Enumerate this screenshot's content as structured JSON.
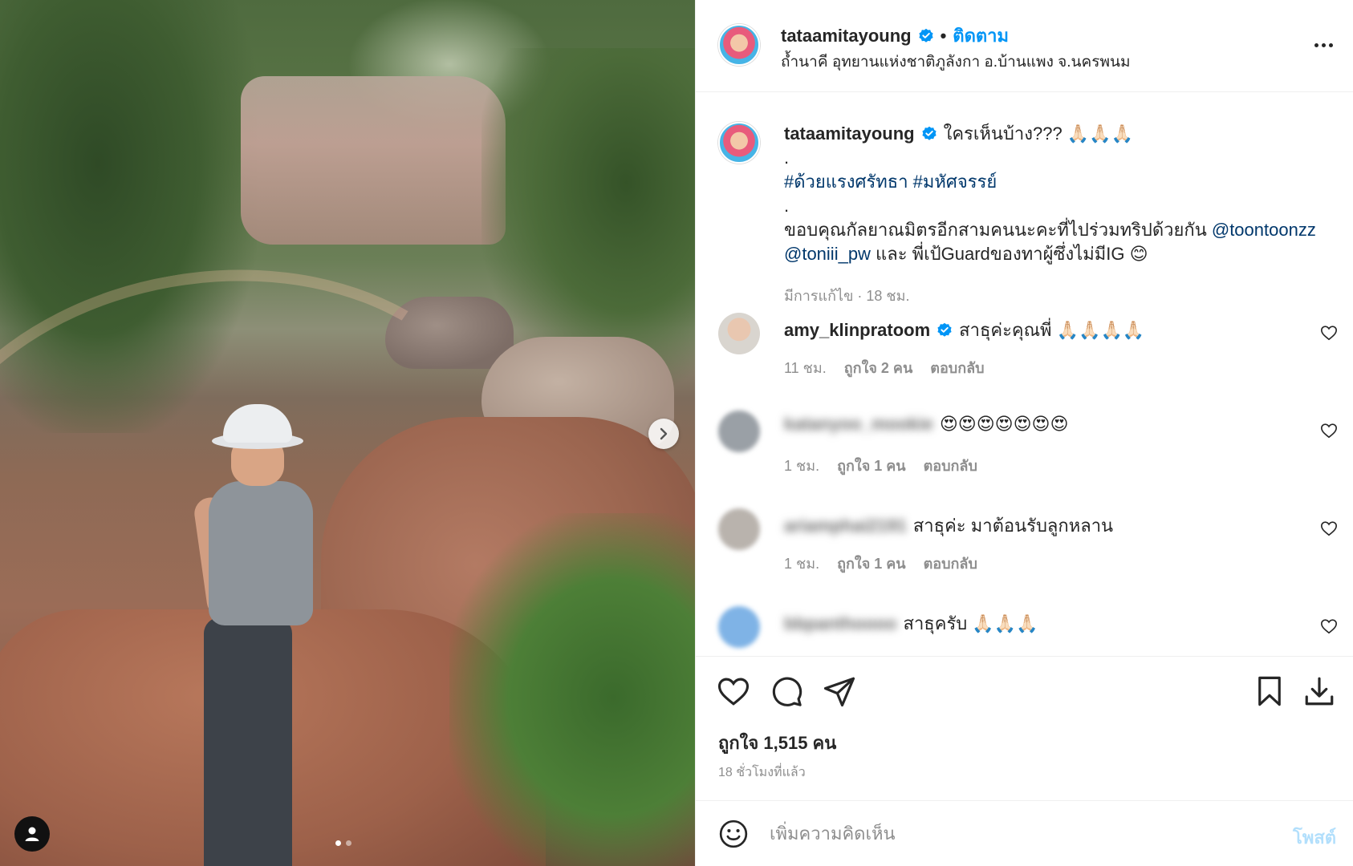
{
  "post": {
    "username": "tataamitayoung",
    "follow_label": "ติดตาม",
    "separator": "•",
    "location": "ถ้ำนาคี อุทยานแห่งชาติภูลังกา อ.บ้านแพง จ.นครพนม",
    "caption": {
      "line1": "ใครเห็นบ้าง??? 🙏🏻🙏🏻🙏🏻",
      "dot1": ".",
      "hashtags": "#ด้วยแรงศรัทธา #มหัศจรรย์",
      "dot2": ".",
      "thanks_text": "ขอบคุณกัลยาณมิตรอีกสามคนนะคะที่ไปร่วมทริปด้วยกัน ",
      "mention1": "@toontoonzz",
      "mention2": "@toniii_pw",
      "tail_text": " และ พี่เป้Guardของทาผู้ซึ่งไม่มีIG 😊",
      "meta": "มีการแก้ไข · 18 ชม."
    },
    "likes": "ถูกใจ 1,515 คน",
    "time_ago": "18 ชั่วโมงที่แล้ว"
  },
  "comments": [
    {
      "user": "amy_klinpratoom",
      "verified": true,
      "text": "สาธุค่ะคุณพี่ 🙏🏻🙏🏻🙏🏻🙏🏻",
      "time": "11 ชม.",
      "likes": "ถูกใจ 2 คน",
      "reply": "ตอบกลับ"
    },
    {
      "user": "katanyoo_mookie",
      "verified": false,
      "text": "😍😍😍😍😍😍😍",
      "time": "1 ชม.",
      "likes": "ถูกใจ 1 คน",
      "reply": "ตอบกลับ"
    },
    {
      "user": "ariamphai2191",
      "verified": false,
      "text": "สาธุค่ะ มาต้อนรับลูกหลาน",
      "time": "1 ชม.",
      "likes": "ถูกใจ 1 คน",
      "reply": "ตอบกลับ"
    },
    {
      "user": "bbpanthoooo",
      "verified": false,
      "text": "สาธุครับ 🙏🏻🙏🏻🙏🏻",
      "time": "",
      "likes": "",
      "reply": ""
    }
  ],
  "add_comment": {
    "placeholder": "เพิ่มความคิดเห็น",
    "post_label": "โพสต์"
  },
  "icons": {
    "verified": "verified-badge-icon",
    "more": "more-options-icon",
    "like": "heart-icon",
    "comment": "comment-bubble-icon",
    "share": "paper-plane-icon",
    "save": "bookmark-icon",
    "download": "download-icon",
    "emoji": "smiley-icon",
    "next": "chevron-right-icon",
    "user_tag": "person-icon"
  },
  "colors": {
    "accent": "#0095f6",
    "text": "#262626",
    "muted": "#8e8e8e",
    "link": "#00376b",
    "post_disabled": "#b2dffc"
  },
  "carousel": {
    "total_slides": 2,
    "current_slide": 1
  }
}
